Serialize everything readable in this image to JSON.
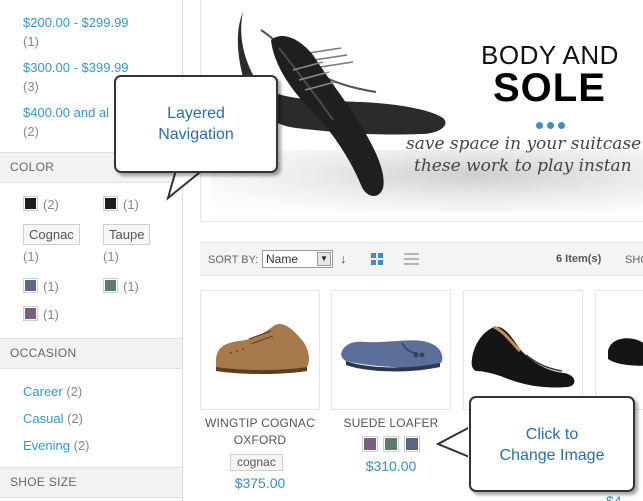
{
  "sidebar": {
    "price": [
      {
        "label": "$200.00 - $299.99",
        "count": "(1)"
      },
      {
        "label": "$300.00 - $399.99",
        "count": "(3)"
      },
      {
        "label": "$400.00 and al",
        "count": "(2)"
      }
    ],
    "color_heading": "COLOR",
    "colors": [
      {
        "name": "black",
        "hex": "#1e1e1e",
        "count": "(2)"
      },
      {
        "name": "black",
        "hex": "#1e1e1e",
        "count": "(1)"
      },
      {
        "name": "Cognac",
        "count": "(1)"
      },
      {
        "name": "Taupe",
        "count": "(1)"
      },
      {
        "name": "slate-blue",
        "hex": "#5e6788",
        "count": "(1)"
      },
      {
        "name": "sage-green",
        "hex": "#5c7d6c",
        "count": "(1)"
      },
      {
        "name": "purple",
        "hex": "#7a5e82",
        "count": "(1)"
      }
    ],
    "occasion_heading": "OCCASION",
    "occasions": [
      {
        "label": "Career",
        "count": "(2)"
      },
      {
        "label": "Casual",
        "count": "(2)"
      },
      {
        "label": "Evening",
        "count": "(2)"
      }
    ],
    "shoe_size_heading": "SHOE SIZE"
  },
  "banner": {
    "title_line1": "BODY AND",
    "title_line2": "SOLE",
    "tagline_line1": "save space in your suitcase",
    "tagline_line2": "these work to play instan"
  },
  "toolbar": {
    "sort_label": "SORT BY:",
    "sort_value": "Name",
    "sort_direction_icon": "arrow-down-icon",
    "view_grid_icon": "grid-view-icon",
    "view_list_icon": "list-view-icon",
    "item_count": "6 Item(s)",
    "show_label": "SHO"
  },
  "products": [
    {
      "name_line1": "WINGTIP COGNAC",
      "name_line2": "OXFORD",
      "tag": "cognac",
      "price": "$375.00"
    },
    {
      "name_line1": "SUEDE LOAFER",
      "price": "$310.00",
      "swatches": [
        {
          "name": "purple",
          "hex": "#7a5e82"
        },
        {
          "name": "sage-green",
          "hex": "#5c7d6c"
        },
        {
          "name": "slate-blue",
          "hex": "#5e6788"
        }
      ]
    },
    {
      "name_line1": "",
      "price": ""
    },
    {
      "name_line1": "",
      "price": "$4"
    }
  ],
  "callouts": {
    "layered_nav": {
      "line1": "Layered",
      "line2": "Navigation"
    },
    "change_image": {
      "line1": "Click to",
      "line2": "Change Image"
    }
  },
  "colors": {
    "link": "#3399cc",
    "accent": "#3b8fc6"
  }
}
